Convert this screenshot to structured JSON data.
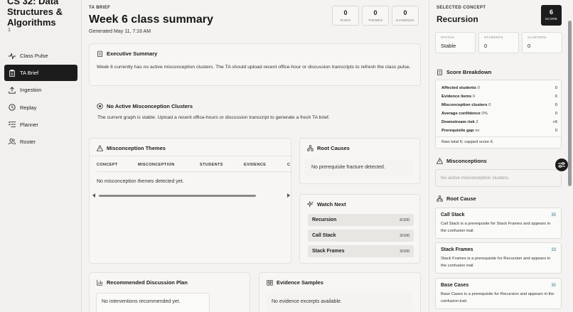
{
  "sidebar": {
    "course_title": "CS 32: Data Structures & Algorithms",
    "course_sub": "1",
    "items": [
      {
        "label": "Class Pulse",
        "icon": "pulse-icon"
      },
      {
        "label": "TA Brief",
        "icon": "clipboard-icon",
        "active": true
      },
      {
        "label": "Ingestion",
        "icon": "upload-icon"
      },
      {
        "label": "Replay",
        "icon": "clock-icon"
      },
      {
        "label": "Planner",
        "icon": "list-icon"
      },
      {
        "label": "Roster",
        "icon": "users-icon"
      }
    ]
  },
  "header": {
    "eyebrow": "TA BRIEF",
    "title": "Week 6 class summary",
    "generated": "Generated May 11, 7:16 AM",
    "stats": [
      {
        "value": "0",
        "label": "RISKS"
      },
      {
        "value": "0",
        "label": "THEMES"
      },
      {
        "value": "0",
        "label": "EVIDENCE"
      }
    ]
  },
  "summary": {
    "title": "Executive Summary",
    "text": "Week 6 currently has no active misconception clusters. The TA should upload recent office-hour or discussion transcripts to refresh the class pulse."
  },
  "no_active": {
    "title": "No Active Misconception Clusters",
    "text": "The current graph is stable. Upload a recent office-hours or discussion transcript to generate a fresh TA brief."
  },
  "themes": {
    "title": "Misconception Themes",
    "columns": [
      "CONCEPT",
      "MISCONCEPTION",
      "STUDENTS",
      "EVIDENCE",
      "C"
    ],
    "empty": "No misconception themes detected yet."
  },
  "root_causes": {
    "title": "Root Causes",
    "empty": "No prerequisite fracture detected."
  },
  "watch_next": {
    "title": "Watch Next",
    "items": [
      {
        "name": "Recursion",
        "value": "6/100"
      },
      {
        "name": "Call Stack",
        "value": "3/100"
      },
      {
        "name": "Stack Frames",
        "value": "3/100"
      }
    ]
  },
  "plan": {
    "title": "Recommended Discussion Plan",
    "empty": "No interventions recommended yet."
  },
  "samples": {
    "title": "Evidence Samples",
    "empty": "No evidence excerpts available."
  },
  "right": {
    "eyebrow": "SELECTED CONCEPT",
    "concept": "Recursion",
    "score_value": "6",
    "score_label": "SCORE",
    "mini": [
      {
        "label": "STATUS",
        "value": "Stable"
      },
      {
        "label": "STUDENTS",
        "value": "0"
      },
      {
        "label": "CLUSTERS",
        "value": "0"
      }
    ],
    "breakdown_title": "Score Breakdown",
    "breakdown": [
      {
        "key": "Affected students",
        "detail": "0",
        "value": "0"
      },
      {
        "key": "Evidence items",
        "detail": "0",
        "value": "0"
      },
      {
        "key": "Misconception clusters",
        "detail": "0",
        "value": "0"
      },
      {
        "key": "Average confidence",
        "detail": "0%",
        "value": "0"
      },
      {
        "key": "Downstream risk",
        "detail": "2",
        "value": "+6"
      },
      {
        "key": "Prerequisite gap",
        "detail": "no",
        "value": "0"
      }
    ],
    "raw_total": "Raw total 6; capped score 6.",
    "misconceptions_title": "Misconceptions",
    "misconceptions_empty": "No active misconception clusters.",
    "root_cause_title": "Root Cause",
    "root_cause_cards": [
      {
        "name": "Call Stack",
        "score": "35",
        "desc": "Call Stack is a prerequisite for Stack Frames and appears in the confusion trail."
      },
      {
        "name": "Stack Frames",
        "score": "33",
        "desc": "Stack Frames is a prerequisite for Recursion and appears in the confusion trail."
      },
      {
        "name": "Base Cases",
        "score": "30",
        "desc": "Base Cases is a prerequisite for Recursion and appears in the confusion trail."
      }
    ]
  }
}
